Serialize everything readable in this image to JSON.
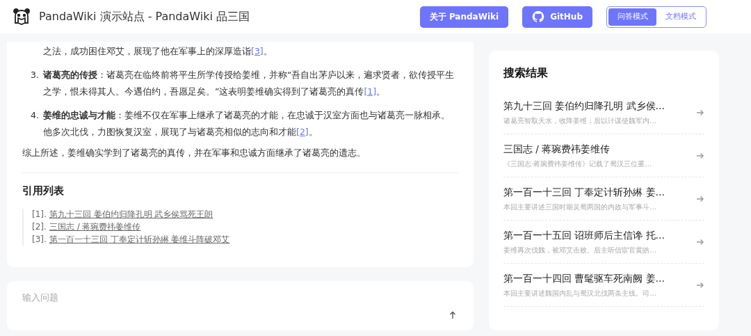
{
  "header": {
    "title": "PandaWiki 演示站点 - PandaWiki 品三国",
    "buttons": [
      {
        "kind": "about",
        "label": "关于 PandaWiki"
      },
      {
        "kind": "github",
        "label": "GitHub"
      }
    ],
    "modes": [
      {
        "label": "问答模式",
        "selected": true
      },
      {
        "label": "文档模式",
        "selected": false
      }
    ]
  },
  "answer": {
    "continuation": {
      "text": "之法，成功困住邓艾，展现了他在军事上的深厚造诣",
      "cite": "[3]",
      "end": "。"
    },
    "items": [
      {
        "number": "3.",
        "text": "**诸葛亮的传授**：诸葛亮在临终前将平生所学传授给姜维，并称“吾自出茅庐以来，遍求贤者，欲传授平生之学，恨未得其人。今遇伯约，吾愿足矣。”这表明姜维确实得到了诸葛亮的真传",
        "cite": "[1]",
        "end": "。"
      },
      {
        "number": "4.",
        "text": "**姜维的忠诚与才能**：姜维不仅在军事上继承了诸葛亮的才能，在忠诚于汉室方面也与诸葛亮一脉相承。他多次北伐，力图恢复汉室，展现了与诸葛亮相似的志向和才能",
        "cite": "[2]",
        "end": "。"
      }
    ],
    "summary": "综上所述，姜维确实学到了诸葛亮的真传，并在军事和忠诚方面继承了诸葛亮的遗志。",
    "references_title": "引用列表",
    "references": [
      {
        "index": "[1].",
        "title": "第九十三回 姜伯约归降孔明 武乡侯骂死王朗"
      },
      {
        "index": "[2].",
        "title": "三国志 / 蒋琬费祎姜维传"
      },
      {
        "index": "[3].",
        "title": "第一百一十三回 丁奉定计斩孙綝 姜维斗阵破邓艾"
      }
    ]
  },
  "question_input": {
    "placeholder": "输入问题"
  },
  "search_results": {
    "title": "搜索结果",
    "items": [
      {
        "title": "第九十三回 姜伯约归降孔明 武乡侯…",
        "snippet": "诸葛亮智取天水，收降姜维；后以计谋使魏军内…"
      },
      {
        "title": "三国志 / 蒋琬费祎姜维传",
        "snippet": "《三国志·蒋琬费祎姜维传》记载了蜀汉三位重…"
      },
      {
        "title": "第一百一十三回 丁奉定计斩孙綝 姜…",
        "snippet": "本回主要讲述三国时期吴蜀两国的内政与军事斗…"
      },
      {
        "title": "第一百一十五回 诏班师后主信谗 托…",
        "snippet": "姜维再次伐魏，被邓艾击败。后主听信宦官黄皓…"
      },
      {
        "title": "第一百一十四回 曹髦驱车死南阙 姜…",
        "snippet": "本回主要讲述魏国内乱与蜀汉北伐两条主线。司…"
      }
    ]
  }
}
